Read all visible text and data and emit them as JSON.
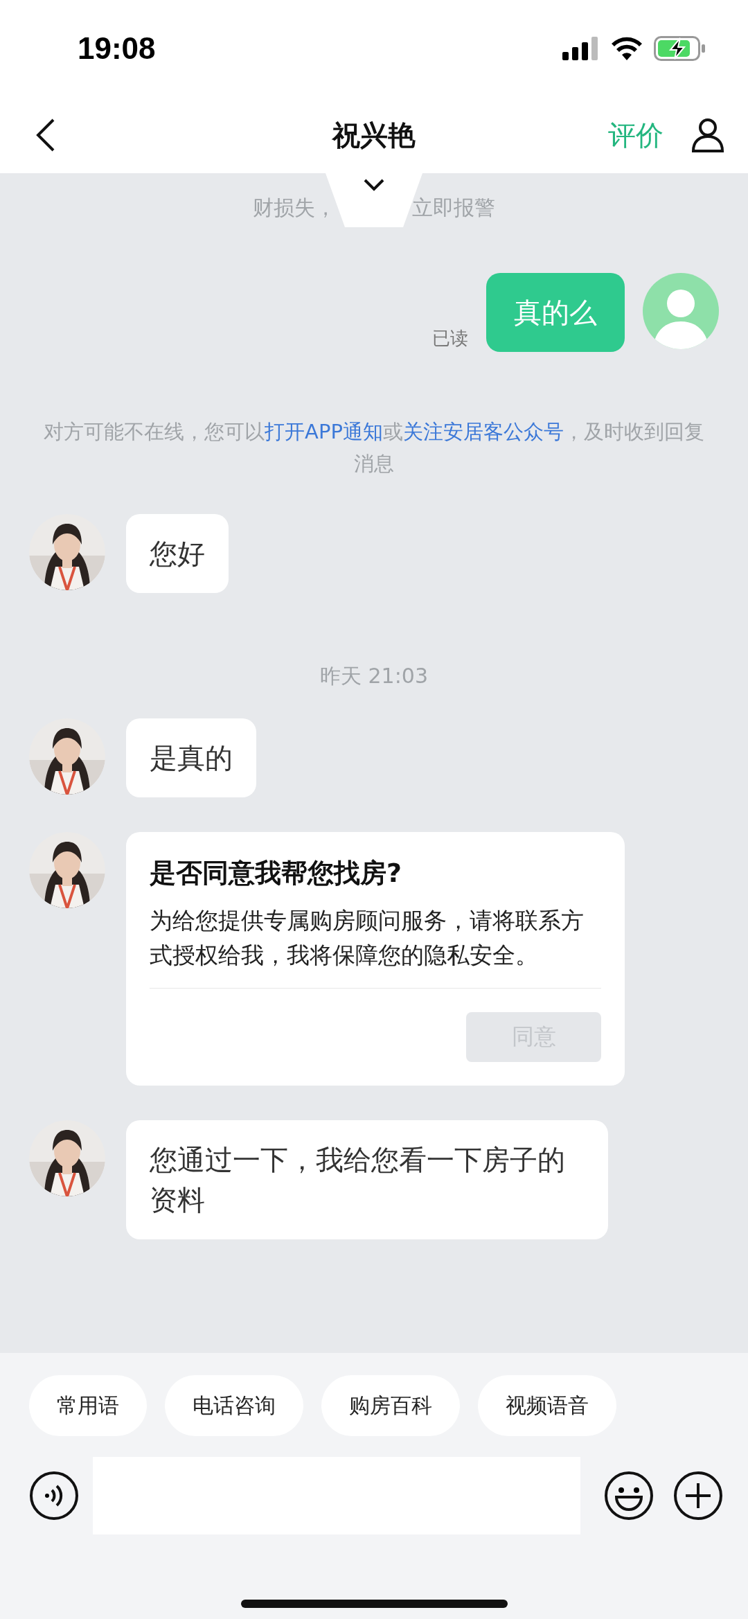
{
  "status_bar": {
    "time": "19:08",
    "battery_charging": true
  },
  "header": {
    "title": "祝兴艳",
    "action": "评价"
  },
  "notice": {
    "before": "财损失，",
    "after": "立即报警"
  },
  "messages": [
    {
      "kind": "sent",
      "text": "真的么",
      "status": "已读"
    },
    {
      "kind": "system",
      "parts": [
        {
          "text": "对方可能不在线，您可以",
          "link": false
        },
        {
          "text": "打开APP通知",
          "link": true
        },
        {
          "text": "或",
          "link": false
        },
        {
          "text": "关注安居客公众号",
          "link": true
        },
        {
          "text": "，及时收到回复消息",
          "link": false
        }
      ]
    },
    {
      "kind": "received",
      "text": "您好"
    },
    {
      "kind": "time",
      "text": "昨天 21:03"
    },
    {
      "kind": "received",
      "text": "是真的"
    },
    {
      "kind": "card",
      "title": "是否同意我帮您找房?",
      "body": "为给您提供专属购房顾问服务，请将联系方式授权给我，我将保障您的隐私安全。",
      "button": {
        "label": "同意",
        "disabled": true
      }
    },
    {
      "kind": "received",
      "text": "您通过一下，我给您看一下房子的资料"
    }
  ],
  "chips": [
    "常用语",
    "电话咨询",
    "购房百科",
    "视频语音"
  ]
}
